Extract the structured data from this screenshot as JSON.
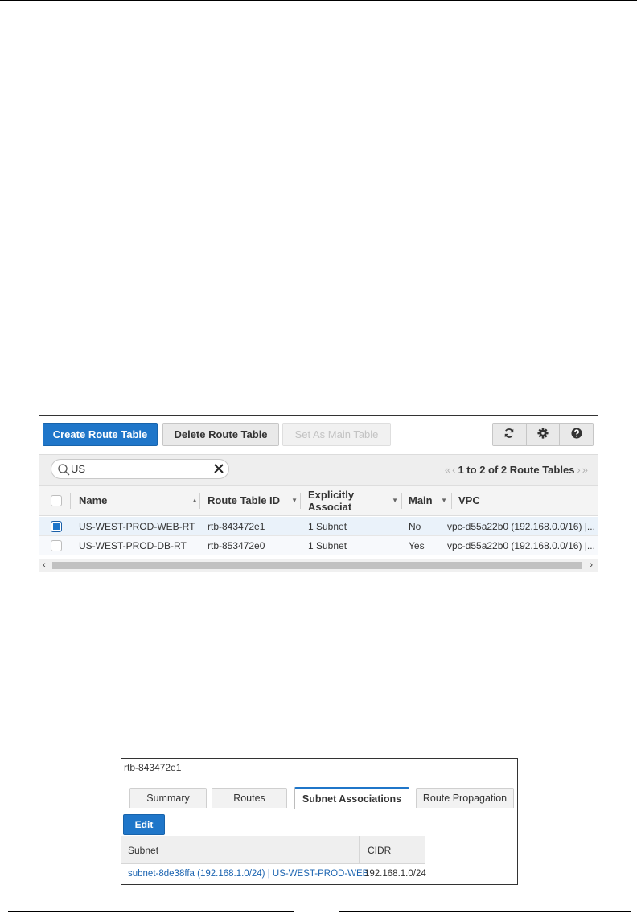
{
  "toolbar": {
    "create_label": "Create Route Table",
    "delete_label": "Delete Route Table",
    "set_main_label": "Set As Main Table"
  },
  "filter": {
    "search_value": "US",
    "pager_text": "1 to 2 of 2 Route Tables"
  },
  "table": {
    "headers": [
      "Name",
      "Route Table ID",
      "Explicitly Associat",
      "Main",
      "VPC"
    ],
    "rows": [
      {
        "selected": true,
        "name": "US-WEST-PROD-WEB-RT",
        "id": "rtb-843472e1",
        "assoc": "1 Subnet",
        "main": "No",
        "vpc": "vpc-d55a22b0 (192.168.0.0/16) |..."
      },
      {
        "selected": false,
        "name": "US-WEST-PROD-DB-RT",
        "id": "rtb-853472e0",
        "assoc": "1 Subnet",
        "main": "Yes",
        "vpc": "vpc-d55a22b0 (192.168.0.0/16) |..."
      }
    ]
  },
  "details": {
    "title": "rtb-843472e1",
    "tabs": [
      "Summary",
      "Routes",
      "Subnet Associations",
      "Route Propagation"
    ],
    "active_tab": "Subnet Associations",
    "edit_label": "Edit",
    "headers": [
      "Subnet",
      "CIDR"
    ],
    "rows": [
      {
        "subnet": "subnet-8de38ffa (192.168.1.0/24) | US-WEST-PROD-WEB",
        "cidr": "192.168.1.0/24"
      }
    ]
  },
  "colors": {
    "primary": "#1f76c9",
    "link": "#1a63b0"
  },
  "icons": [
    "refresh-icon",
    "gear-icon",
    "help-icon",
    "search-icon",
    "clear-icon"
  ]
}
